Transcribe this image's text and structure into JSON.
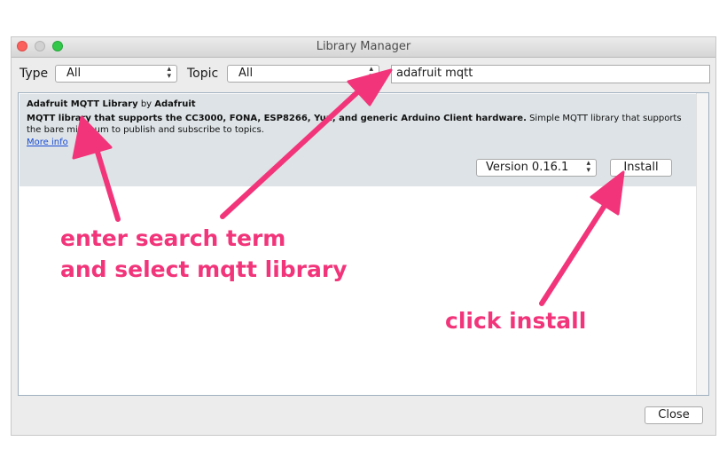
{
  "window": {
    "title": "Library Manager"
  },
  "filters": {
    "type_label": "Type",
    "type_value": "All",
    "topic_label": "Topic",
    "topic_value": "All",
    "search_value": "adafruit mqtt"
  },
  "library": {
    "name": "Adafruit MQTT Library",
    "by": "by",
    "author": "Adafruit",
    "description_bold": "MQTT library that supports the CC3000, FONA, ESP8266, Yun, and generic Arduino Client hardware.",
    "description_rest": "Simple MQTT library that supports the bare minimum to publish and subscribe to topics.",
    "more_info": "More info",
    "version": "Version 0.16.1",
    "install_label": "Install"
  },
  "footer": {
    "close_label": "Close"
  },
  "annotations": {
    "line1": "enter search term",
    "line2": "and select mqtt library",
    "line3": "click install"
  },
  "colors": {
    "annotation": "#f2357a",
    "item_bg": "#dde3e6",
    "link": "#1a4cd6"
  },
  "icons": [
    "close-window-icon",
    "minimize-window-icon",
    "zoom-window-icon",
    "up-down-arrows-icon",
    "annotation-arrow-icon"
  ]
}
